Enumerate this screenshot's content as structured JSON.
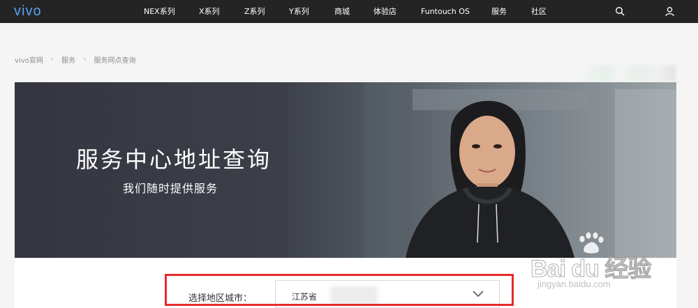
{
  "nav": {
    "logo": "vivo",
    "items": [
      "NEX系列",
      "X系列",
      "Z系列",
      "Y系列",
      "商城",
      "体验店",
      "Funtouch OS",
      "服务",
      "社区"
    ],
    "search_icon": "search-icon",
    "user_icon": "user-icon"
  },
  "breadcrumb": [
    "vivo官网",
    "服务",
    "服务网点查询"
  ],
  "banner": {
    "title": "服务中心地址查询",
    "subtitle": "我们随时提供服务"
  },
  "form": {
    "region_label": "选择地区城市：",
    "province_value": "江苏省"
  },
  "watermark": {
    "logo": "Bai du 经验",
    "url": "jingyan.baidu.com"
  },
  "colors": {
    "nav_bg": "#242424",
    "highlight": "#e52b2b",
    "logo": "#5aa0f5"
  }
}
